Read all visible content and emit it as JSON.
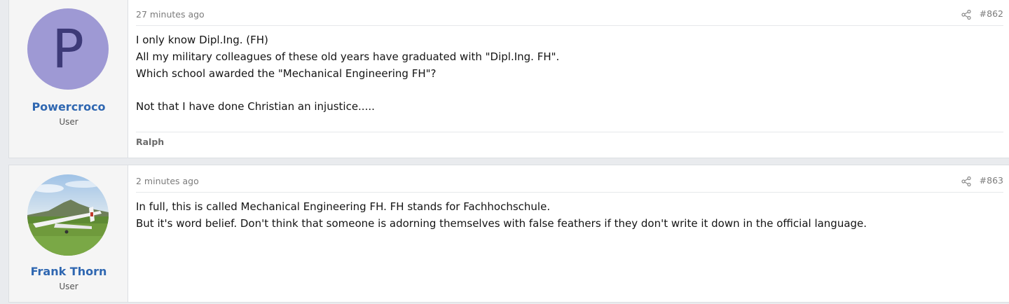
{
  "posts": [
    {
      "username": "Powercroco",
      "user_title": "User",
      "avatar_letter": "P",
      "timestamp": "27 minutes ago",
      "post_number": "#862",
      "body_lines": [
        "I only know Dipl.Ing. (FH)",
        "All my military colleagues of these old years have graduated with \"Dipl.Ing. FH\".",
        "Which school awarded the \"Mechanical Engineering FH\"?",
        "",
        "Not that I have done Christian an injustice....."
      ],
      "signature": "Ralph"
    },
    {
      "username": "Frank Thorn",
      "user_title": "User",
      "avatar_icon": "glider-photo",
      "timestamp": "2 minutes ago",
      "post_number": "#863",
      "body_lines": [
        "In full, this is called Mechanical Engineering FH. FH stands for Fachhochschule.",
        "But it's word belief. Don't think that someone is adorning themselves with false feathers if they don't write it down in the official language."
      ]
    }
  ],
  "colors": {
    "username": "#2f67b1",
    "avatar_bg": "#9e99d4",
    "avatar_letter": "#3d3a78"
  },
  "icons": {
    "share": "share-icon"
  }
}
